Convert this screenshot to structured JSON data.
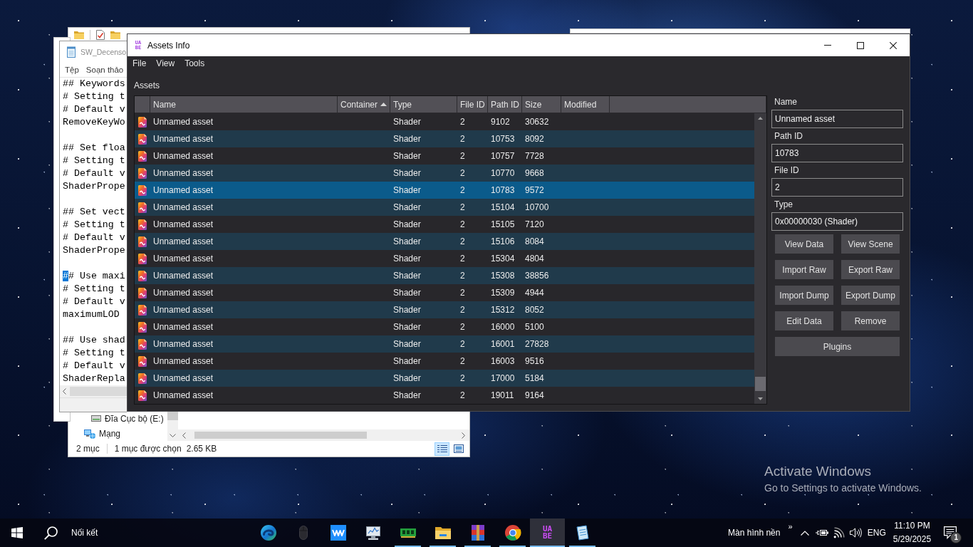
{
  "explorer_window": {
    "nav_items": [
      {
        "kind": "drive",
        "label": "Đĩa Cục bộ (E:)"
      },
      {
        "kind": "network",
        "label": "Mạng"
      }
    ],
    "status_bar": {
      "item_count": "2 mục",
      "selection": "1 mục được chọn",
      "selection_size": "2.65 KB"
    },
    "view_buttons": [
      {
        "kind": "details",
        "selected": true
      },
      {
        "kind": "large_icons",
        "selected": false
      }
    ]
  },
  "notepad_window": {
    "title": "SW_Decenso",
    "menu": [
      "Tệp",
      "Soạn thảo"
    ],
    "blocks": [
      [
        "## Keywords",
        "# Setting t",
        "# Default v",
        "RemoveKeyWo"
      ],
      [
        "## Set floa",
        "# Setting t",
        "# Default v",
        "ShaderPrope"
      ],
      [
        "## Set vect",
        "# Setting t",
        "# Default v",
        "ShaderPrope"
      ],
      [
        {
          "selected_text": "#",
          "rest": "# Use maxi"
        },
        "# Setting t",
        "# Default v",
        "maximumLOD"
      ],
      [
        "## Use shad",
        "# Setting t",
        "# Default v",
        "ShaderRepla"
      ]
    ]
  },
  "assets_window": {
    "logo": [
      "UA",
      "BE"
    ],
    "title": "Assets Info",
    "menu": [
      "File",
      "View",
      "Tools"
    ],
    "section_label": "Assets",
    "table": {
      "columns": [
        {
          "label": "Name",
          "sorted": false
        },
        {
          "label": "Container",
          "sorted": true
        },
        {
          "label": "Type",
          "sorted": false
        },
        {
          "label": "File ID",
          "sorted": false
        },
        {
          "label": "Path ID",
          "sorted": false
        },
        {
          "label": "Size",
          "sorted": false
        },
        {
          "label": "Modified",
          "sorted": false
        }
      ],
      "rows": [
        {
          "name": "Unnamed asset",
          "type": "Shader",
          "file_id": "2",
          "path_id": "9102",
          "size": "30632",
          "selected": false
        },
        {
          "name": "Unnamed asset",
          "type": "Shader",
          "file_id": "2",
          "path_id": "10753",
          "size": "8092",
          "selected": false
        },
        {
          "name": "Unnamed asset",
          "type": "Shader",
          "file_id": "2",
          "path_id": "10757",
          "size": "7728",
          "selected": false
        },
        {
          "name": "Unnamed asset",
          "type": "Shader",
          "file_id": "2",
          "path_id": "10770",
          "size": "9668",
          "selected": false
        },
        {
          "name": "Unnamed asset",
          "type": "Shader",
          "file_id": "2",
          "path_id": "10783",
          "size": "9572",
          "selected": true
        },
        {
          "name": "Unnamed asset",
          "type": "Shader",
          "file_id": "2",
          "path_id": "15104",
          "size": "10700",
          "selected": false
        },
        {
          "name": "Unnamed asset",
          "type": "Shader",
          "file_id": "2",
          "path_id": "15105",
          "size": "7120",
          "selected": false
        },
        {
          "name": "Unnamed asset",
          "type": "Shader",
          "file_id": "2",
          "path_id": "15106",
          "size": "8084",
          "selected": false
        },
        {
          "name": "Unnamed asset",
          "type": "Shader",
          "file_id": "2",
          "path_id": "15304",
          "size": "4804",
          "selected": false
        },
        {
          "name": "Unnamed asset",
          "type": "Shader",
          "file_id": "2",
          "path_id": "15308",
          "size": "38856",
          "selected": false
        },
        {
          "name": "Unnamed asset",
          "type": "Shader",
          "file_id": "2",
          "path_id": "15309",
          "size": "4944",
          "selected": false
        },
        {
          "name": "Unnamed asset",
          "type": "Shader",
          "file_id": "2",
          "path_id": "15312",
          "size": "8052",
          "selected": false
        },
        {
          "name": "Unnamed asset",
          "type": "Shader",
          "file_id": "2",
          "path_id": "16000",
          "size": "5100",
          "selected": false
        },
        {
          "name": "Unnamed asset",
          "type": "Shader",
          "file_id": "2",
          "path_id": "16001",
          "size": "27828",
          "selected": false
        },
        {
          "name": "Unnamed asset",
          "type": "Shader",
          "file_id": "2",
          "path_id": "16003",
          "size": "9516",
          "selected": false
        },
        {
          "name": "Unnamed asset",
          "type": "Shader",
          "file_id": "2",
          "path_id": "17000",
          "size": "5184",
          "selected": false
        },
        {
          "name": "Unnamed asset",
          "type": "Shader",
          "file_id": "2",
          "path_id": "19011",
          "size": "9164",
          "selected": false
        }
      ]
    },
    "details": {
      "fields": [
        {
          "label": "Name",
          "value": "Unnamed asset"
        },
        {
          "label": "Path ID",
          "value": "10783"
        },
        {
          "label": "File ID",
          "value": "2"
        },
        {
          "label": "Type",
          "value": "0x00000030 (Shader)"
        }
      ],
      "buttons": [
        {
          "label": "View Data",
          "kind": "half"
        },
        {
          "label": "View Scene",
          "kind": "half"
        },
        {
          "label": "Import Raw",
          "kind": "half"
        },
        {
          "label": "Export Raw",
          "kind": "half"
        },
        {
          "label": "Import Dump",
          "kind": "half"
        },
        {
          "label": "Export Dump",
          "kind": "half"
        },
        {
          "label": "Edit Data",
          "kind": "half"
        },
        {
          "label": "Remove",
          "kind": "half"
        },
        {
          "label": "Plugins",
          "kind": "wide"
        }
      ]
    }
  },
  "desktop": {
    "activation_notice": {
      "title": "Activate Windows",
      "text": "Go to Settings to activate Windows."
    }
  },
  "taskbar": {
    "links_label": "Nối kết",
    "apps": [
      {
        "kind": "globe",
        "running": false,
        "selected": false
      },
      {
        "kind": "mouse",
        "running": false,
        "selected": false
      },
      {
        "kind": "waveform",
        "running": false,
        "selected": false
      },
      {
        "kind": "monitor",
        "running": false,
        "selected": false
      },
      {
        "kind": "chip",
        "running": true,
        "selected": false
      },
      {
        "kind": "folder",
        "running": true,
        "selected": false
      },
      {
        "kind": "archive",
        "running": true,
        "selected": false
      },
      {
        "kind": "browser",
        "running": true,
        "selected": false
      },
      {
        "kind": "logo",
        "lines": [
          "UA",
          "BE"
        ],
        "running": true,
        "selected": true
      },
      {
        "kind": "notepad",
        "running": true,
        "selected": false
      }
    ],
    "tray": {
      "desktop_label": "Màn hình nền",
      "overflow": "»",
      "language": "ENG",
      "time": "11:10 PM",
      "date": "5/29/2025",
      "notification_count": "1"
    }
  }
}
